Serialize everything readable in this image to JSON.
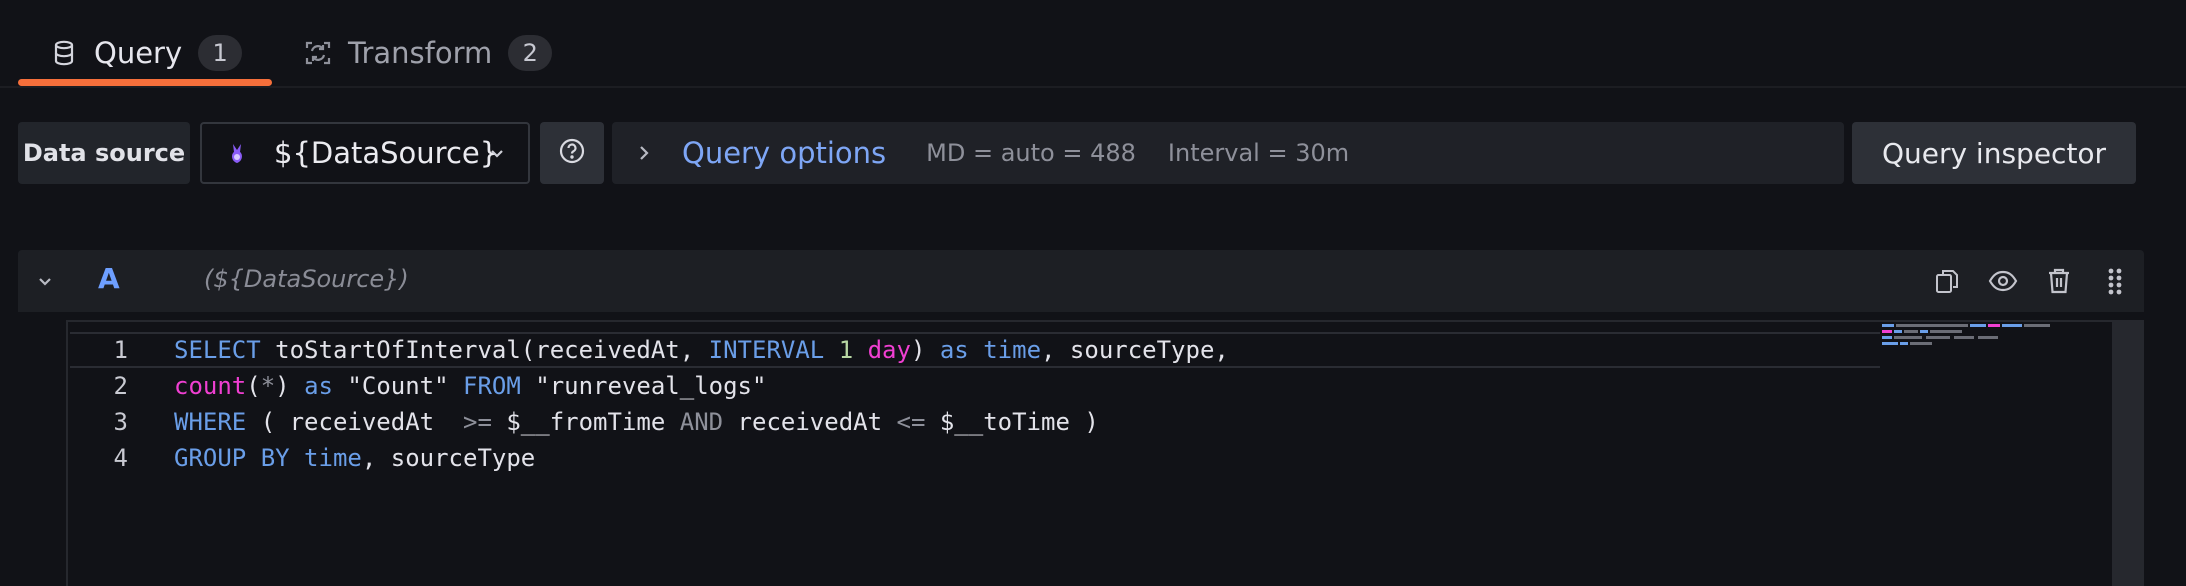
{
  "tabs": [
    {
      "label": "Query",
      "count": "1",
      "icon": "database-icon",
      "active": true
    },
    {
      "label": "Transform",
      "count": "2",
      "icon": "transform-icon",
      "active": false
    }
  ],
  "toolbar": {
    "datasource_label": "Data source",
    "datasource_value": "${DataSource}",
    "query_options_label": "Query options",
    "md": "MD = auto = 488",
    "interval": "Interval = 30m",
    "inspector_label": "Query inspector"
  },
  "query": {
    "ref_id": "A",
    "datasource": "(${DataSource})"
  },
  "editor": {
    "lines": [
      {
        "n": "1",
        "tokens": [
          {
            "t": "SELECT",
            "c": "kw"
          },
          {
            "t": " toStartOfInterval(receivedAt, ",
            "c": ""
          },
          {
            "t": "INTERVAL",
            "c": "kw"
          },
          {
            "t": " ",
            "c": ""
          },
          {
            "t": "1",
            "c": "num"
          },
          {
            "t": " ",
            "c": ""
          },
          {
            "t": "day",
            "c": "fn"
          },
          {
            "t": ") ",
            "c": ""
          },
          {
            "t": "as",
            "c": "kw"
          },
          {
            "t": " ",
            "c": ""
          },
          {
            "t": "time",
            "c": "kw"
          },
          {
            "t": ", sourceType,",
            "c": ""
          }
        ]
      },
      {
        "n": "2",
        "tokens": [
          {
            "t": "count",
            "c": "fn"
          },
          {
            "t": "(",
            "c": ""
          },
          {
            "t": "*",
            "c": "op"
          },
          {
            "t": ") ",
            "c": ""
          },
          {
            "t": "as",
            "c": "kw"
          },
          {
            "t": " \"Count\" ",
            "c": ""
          },
          {
            "t": "FROM",
            "c": "kw"
          },
          {
            "t": " \"runreveal_logs\"",
            "c": ""
          }
        ]
      },
      {
        "n": "3",
        "tokens": [
          {
            "t": "WHERE",
            "c": "kw"
          },
          {
            "t": " ( receivedAt  ",
            "c": ""
          },
          {
            "t": ">=",
            "c": "op"
          },
          {
            "t": " $__fromTime ",
            "c": ""
          },
          {
            "t": "AND",
            "c": "op"
          },
          {
            "t": " receivedAt ",
            "c": ""
          },
          {
            "t": "<=",
            "c": "op"
          },
          {
            "t": " $__toTime )",
            "c": ""
          }
        ]
      },
      {
        "n": "4",
        "tokens": [
          {
            "t": "GROUP BY",
            "c": "kw"
          },
          {
            "t": " ",
            "c": ""
          },
          {
            "t": "time",
            "c": "kw"
          },
          {
            "t": ", sourceType",
            "c": ""
          }
        ]
      }
    ]
  },
  "colors": {
    "accent_underline": "#f56f3b",
    "keyword": "#6a9ee8",
    "function": "#f03fd2",
    "link": "#7ea6f5"
  }
}
